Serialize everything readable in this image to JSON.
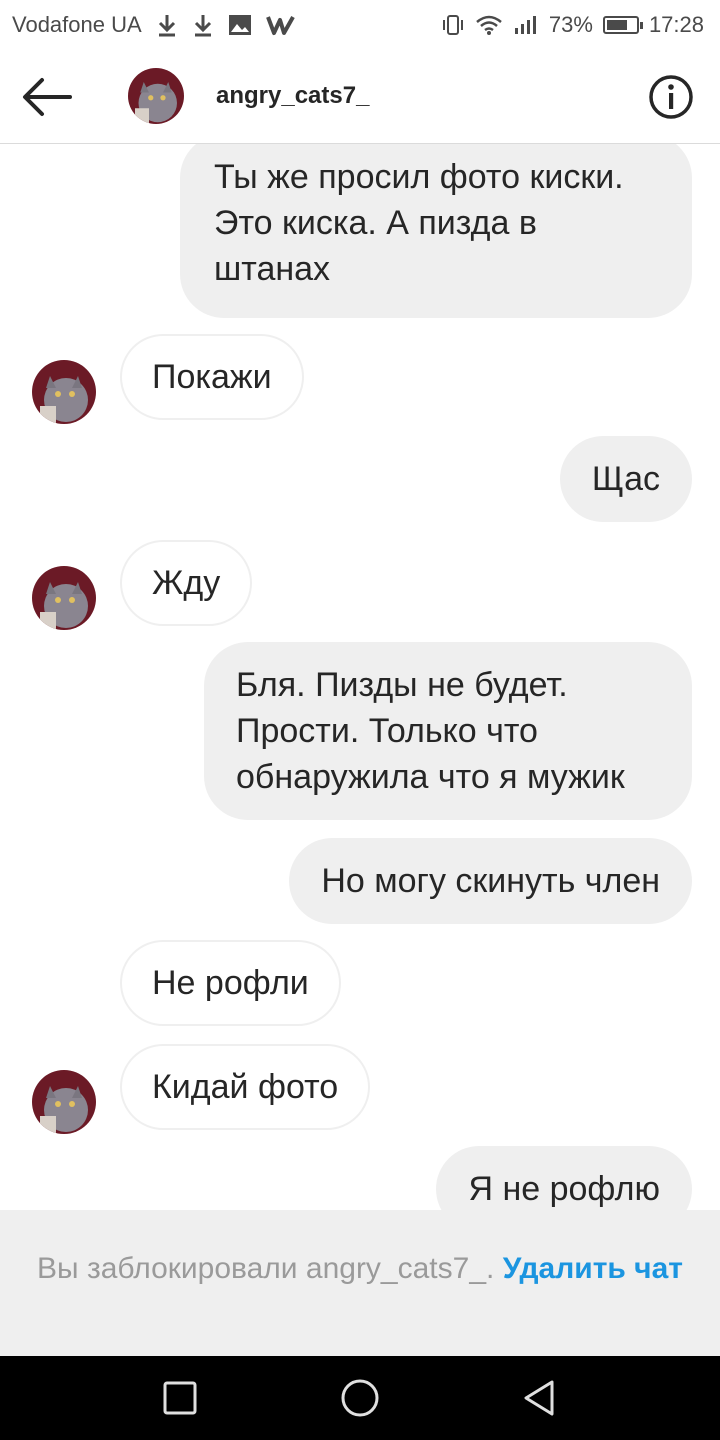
{
  "status_bar": {
    "carrier": "Vodafone UA",
    "battery_percent": "73%",
    "battery_level": 0.73,
    "time": "17:28",
    "icons": [
      "download-icon",
      "download-icon",
      "image-icon",
      "w-app-icon",
      "vibrate-icon",
      "wifi-icon",
      "signal-icon",
      "battery-icon"
    ]
  },
  "header": {
    "username": "angry_cats7_",
    "icons": [
      "back-arrow-icon",
      "info-icon"
    ]
  },
  "messages": [
    {
      "side": "out",
      "text": "Ты же просил фото киски. Это киска. А пизда в штанах"
    },
    {
      "side": "in",
      "text": "Покажи",
      "avatar": true
    },
    {
      "side": "out",
      "text": "Щас"
    },
    {
      "side": "in",
      "text": "Жду",
      "avatar": true
    },
    {
      "side": "out",
      "text": "Бля. Пизды не будет. Прости. Только что обнаружила что я мужик"
    },
    {
      "side": "out",
      "text": "Но могу скинуть член"
    },
    {
      "side": "in",
      "text": "Не рофли",
      "avatar": false
    },
    {
      "side": "in",
      "text": "Кидай фото",
      "avatar": true
    },
    {
      "side": "out",
      "text": "Я не рофлю"
    }
  ],
  "blocked_banner": {
    "text": "Вы заблокировали angry_cats7_.",
    "action": "Удалить чат"
  },
  "navbar": {
    "icons": [
      "square-recent-icon",
      "circle-home-icon",
      "triangle-back-icon"
    ]
  },
  "colors": {
    "outgoing_bubble": "#efefef",
    "link_blue": "#1b95e0",
    "banner_bg": "#efefef"
  }
}
